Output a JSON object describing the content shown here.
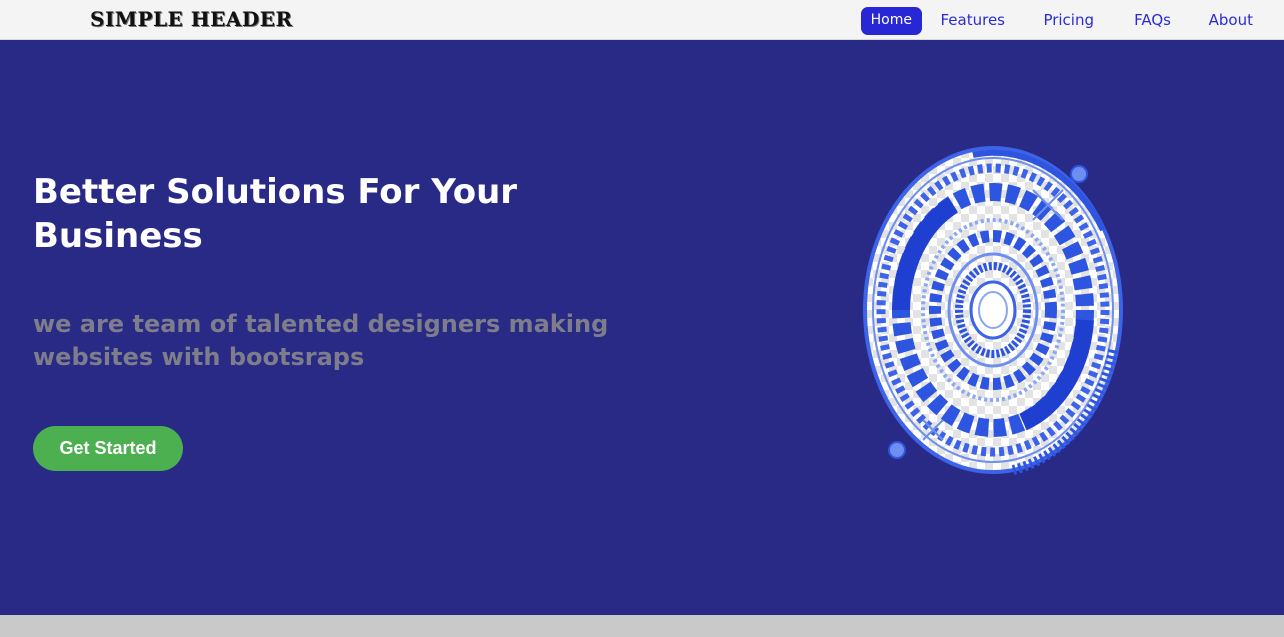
{
  "header": {
    "logo": "SIMPLE HEADER",
    "nav": [
      {
        "label": "Home",
        "active": true
      },
      {
        "label": "Features",
        "active": false
      },
      {
        "label": "Pricing",
        "active": false
      },
      {
        "label": "FAQs",
        "active": false
      },
      {
        "label": "About",
        "active": false
      }
    ]
  },
  "hero": {
    "title": "Better Solutions For Your Business",
    "subtitle": "we are team of talented designers making websites with bootsraps",
    "cta_label": "Get Started"
  },
  "colors": {
    "hero_bg": "#292986",
    "nav_accent": "#2727d6",
    "cta_bg": "#4caf50",
    "subtitle_text": "#7d7d8c",
    "graphic_blue": "#2d55e0"
  }
}
